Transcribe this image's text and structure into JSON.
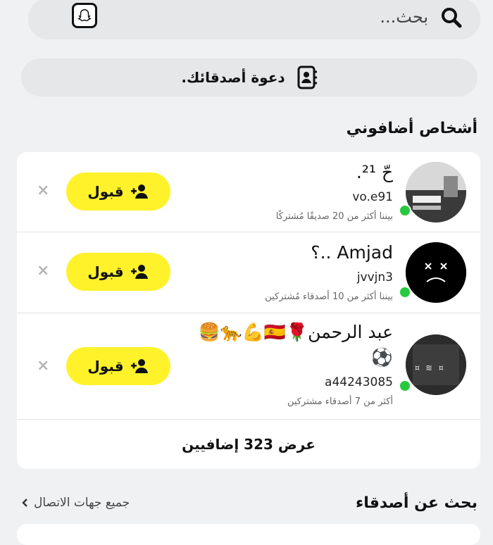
{
  "search": {
    "placeholder": "بحث..."
  },
  "invite": {
    "label": "دعوة أصدقائك."
  },
  "added_me": {
    "title": "أشخاص أضافوني",
    "accept_label": "قبول",
    "close_symbol": "×",
    "rows": [
      {
        "name": "حّ ²¹.",
        "username": "vo.e91",
        "mutual": "بيننا أكثر من 20 صديقًا مُشتركًا"
      },
      {
        "name": "Amjad ..؟",
        "username": "jvvjn3",
        "mutual": "بيننا أكثر من 10 أصدقاء مُشتركين"
      },
      {
        "name": "عبد الرحمن🌹🇪🇸💪🐆🍔",
        "name2": "⚽",
        "username": "a44243085",
        "mutual": "أكثر من 7 أصدقاء مشتركين"
      }
    ],
    "show_more": "عرض 323 إضافيين"
  },
  "find_friends": {
    "title": "بحث عن أصدقاء",
    "all_contacts": "جميع جهات الاتصال"
  },
  "colors": {
    "accept": "#fff22a",
    "online": "#27c93f"
  }
}
